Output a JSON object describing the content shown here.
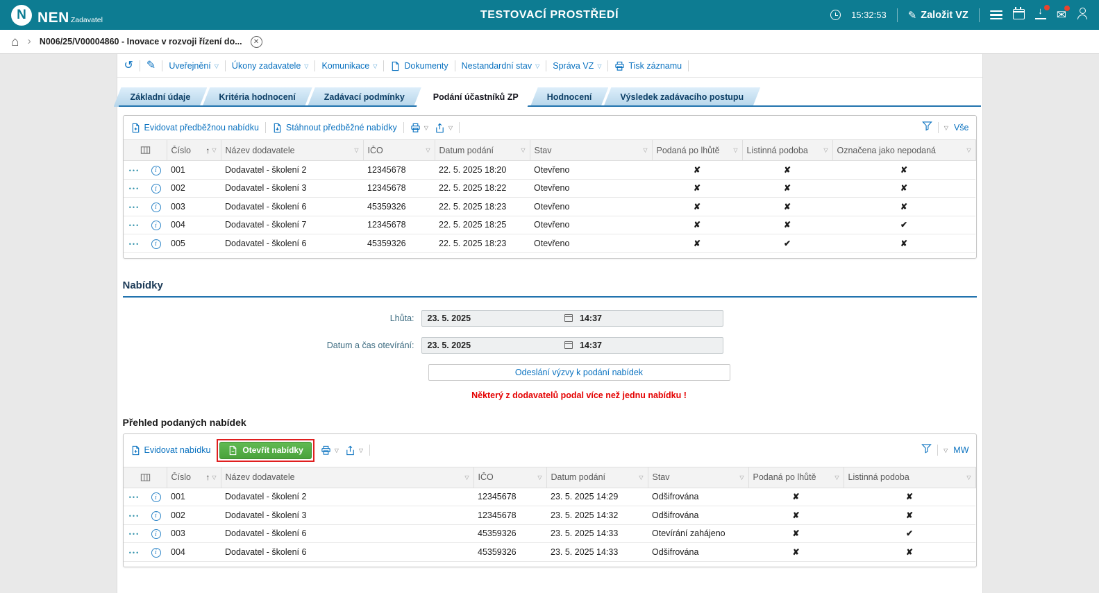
{
  "colors": {
    "header_bg": "#0d7c92",
    "link_blue": "#0a72c0",
    "tab_line": "#2273ae",
    "red_flag": "#d9261c",
    "green_flag": "#2e9e27",
    "button_green": "#4aa23c",
    "warning_red": "#e40000"
  },
  "icons": {
    "clock": "clock-icon",
    "sort_asc": "↑",
    "caret": "▽",
    "check": "✔",
    "cross": "✘",
    "chevron": "›",
    "home": "⌂",
    "history": "↺",
    "pencil": "✎",
    "mail": "✉",
    "down_arrow": "↓",
    "close": "✕",
    "dots_menu": "●●●",
    "info": "i"
  },
  "header": {
    "logo": "NEN",
    "logo_sub": "Zadavatel",
    "title": "TESTOVACÍ PROSTŘEDÍ",
    "time": "15:32:53",
    "create_button": "Založit VZ"
  },
  "breadcrumb": {
    "item": "N006/25/V00004860 - Inovace v rozvoji řízení do..."
  },
  "actions": {
    "items": [
      {
        "label": "Uveřejnění"
      },
      {
        "label": "Úkony zadavatele"
      },
      {
        "label": "Komunikace"
      },
      {
        "label": "Dokumenty"
      },
      {
        "label": "Nestandardní stav"
      },
      {
        "label": "Správa VZ"
      },
      {
        "label": "Tisk záznamu"
      }
    ]
  },
  "tabs": {
    "items": [
      {
        "label": "Základní údaje",
        "active": false
      },
      {
        "label": "Kritéria hodnocení",
        "active": false
      },
      {
        "label": "Zadávací podmínky",
        "active": false
      },
      {
        "label": "Podání účastníků ZP",
        "active": true
      },
      {
        "label": "Hodnocení",
        "active": false
      },
      {
        "label": "Výsledek zadávacího postupu",
        "active": false
      }
    ]
  },
  "preliminary": {
    "toolbar": {
      "action_evidovat": "Evidovat předběžnou nabídku",
      "action_stahnout": "Stáhnout předběžné nabídky",
      "view": "Vše"
    },
    "columns": [
      {
        "label": "Číslo",
        "sorted": true
      },
      {
        "label": "Název dodavatele",
        "sorted": false
      },
      {
        "label": "IČO",
        "sorted": false
      },
      {
        "label": "Datum podání",
        "sorted": false
      },
      {
        "label": "Stav",
        "sorted": false
      },
      {
        "label": "Podaná po lhůtě",
        "sorted": false
      },
      {
        "label": "Listinná podoba",
        "sorted": false
      },
      {
        "label": "Označena jako nepodaná",
        "sorted": false
      }
    ],
    "rows": [
      {
        "cislo": "001",
        "dodavatel": "Dodavatel - školení 2",
        "ico": "12345678",
        "datum": "22. 5. 2025 18:20",
        "stav": "Otevřeno",
        "flags": [
          false,
          false,
          false
        ]
      },
      {
        "cislo": "002",
        "dodavatel": "Dodavatel - školení 3",
        "ico": "12345678",
        "datum": "22. 5. 2025 18:22",
        "stav": "Otevřeno",
        "flags": [
          false,
          false,
          false
        ]
      },
      {
        "cislo": "003",
        "dodavatel": "Dodavatel - školení 6",
        "ico": "45359326",
        "datum": "22. 5. 2025 18:23",
        "stav": "Otevřeno",
        "flags": [
          false,
          false,
          false
        ]
      },
      {
        "cislo": "004",
        "dodavatel": "Dodavatel - školení 7",
        "ico": "12345678",
        "datum": "22. 5. 2025 18:25",
        "stav": "Otevřeno",
        "flags": [
          false,
          false,
          true
        ]
      },
      {
        "cislo": "005",
        "dodavatel": "Dodavatel - školení 6",
        "ico": "45359326",
        "datum": "22. 5. 2025 18:23",
        "stav": "Otevřeno",
        "flags": [
          false,
          true,
          false
        ]
      }
    ]
  },
  "nabidky": {
    "title": "Nabídky",
    "lhuta_label": "Lhůta:",
    "lhuta_date": "23. 5. 2025",
    "lhuta_time": "14:37",
    "oteviranni_label": "Datum a čas otevírání:",
    "oteviranni_date": "23. 5. 2025",
    "oteviranni_time": "14:37",
    "send_button": "Odeslání výzvy k podání nabídek",
    "warning": "Některý z dodavatelů podal více než jednu nabídku !"
  },
  "podane": {
    "title": "Přehled podaných nabídek",
    "toolbar": {
      "action_evidovat": "Evidovat nabídku",
      "action_otevrit": "Otevřít nabídky",
      "view": "MW"
    },
    "columns": [
      {
        "label": "Číslo",
        "sorted": true
      },
      {
        "label": "Název dodavatele",
        "sorted": false
      },
      {
        "label": "IČO",
        "sorted": false
      },
      {
        "label": "Datum podání",
        "sorted": false
      },
      {
        "label": "Stav",
        "sorted": false
      },
      {
        "label": "Podaná po lhůtě",
        "sorted": false
      },
      {
        "label": "Listinná podoba",
        "sorted": false
      }
    ],
    "rows": [
      {
        "cislo": "001",
        "dodavatel": "Dodavatel - školení 2",
        "ico": "12345678",
        "datum": "23. 5. 2025 14:29",
        "stav": "Odšifrována",
        "flags": [
          false,
          false
        ]
      },
      {
        "cislo": "002",
        "dodavatel": "Dodavatel - školení 3",
        "ico": "12345678",
        "datum": "23. 5. 2025 14:32",
        "stav": "Odšifrována",
        "flags": [
          false,
          false
        ]
      },
      {
        "cislo": "003",
        "dodavatel": "Dodavatel - školení 6",
        "ico": "45359326",
        "datum": "23. 5. 2025 14:33",
        "stav": "Otevírání zahájeno",
        "flags": [
          false,
          true
        ]
      },
      {
        "cislo": "004",
        "dodavatel": "Dodavatel - školení 6",
        "ico": "45359326",
        "datum": "23. 5. 2025 14:33",
        "stav": "Odšifrována",
        "flags": [
          false,
          false
        ]
      }
    ]
  }
}
